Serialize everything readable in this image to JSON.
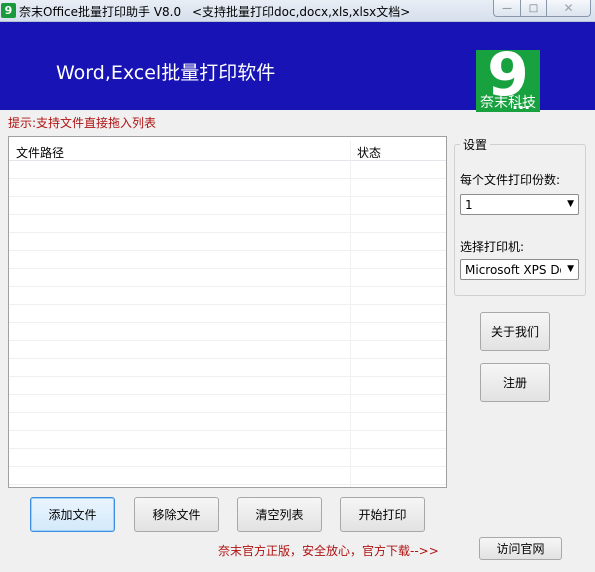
{
  "window": {
    "title": "奈末Office批量打印助手 V8.0",
    "subtitle": "<支持批量打印doc,docx,xls,xlsx文档>",
    "app_icon_glyph": "9",
    "minimize_glyph": "—",
    "maximize_glyph": "□",
    "close_glyph": "✕"
  },
  "banner": {
    "title": "Word,Excel批量打印软件",
    "logo_glyph": "9",
    "logo_dots": "...",
    "logo_text": "奈末科技",
    "background_color": "#1813b5",
    "logo_color": "#18a23f"
  },
  "hint": "提示:支持文件直接拖入列表",
  "file_list": {
    "columns": [
      "文件路径",
      "状态"
    ],
    "rows": []
  },
  "settings": {
    "group_title": "设置",
    "copies_label": "每个文件打印份数:",
    "copies_value": "1",
    "printer_label": "选择打印机:",
    "printer_value": "Microsoft XPS Document Writer",
    "dropdown_arrow": "▼"
  },
  "buttons": {
    "about": "关于我们",
    "register": "注册",
    "add_file": "添加文件",
    "remove_file": "移除文件",
    "clear_list": "清空列表",
    "start_print": "开始打印",
    "visit_site": "访问官网"
  },
  "footer": {
    "promo": "奈末官方正版，安全放心，官方下载-->>"
  }
}
